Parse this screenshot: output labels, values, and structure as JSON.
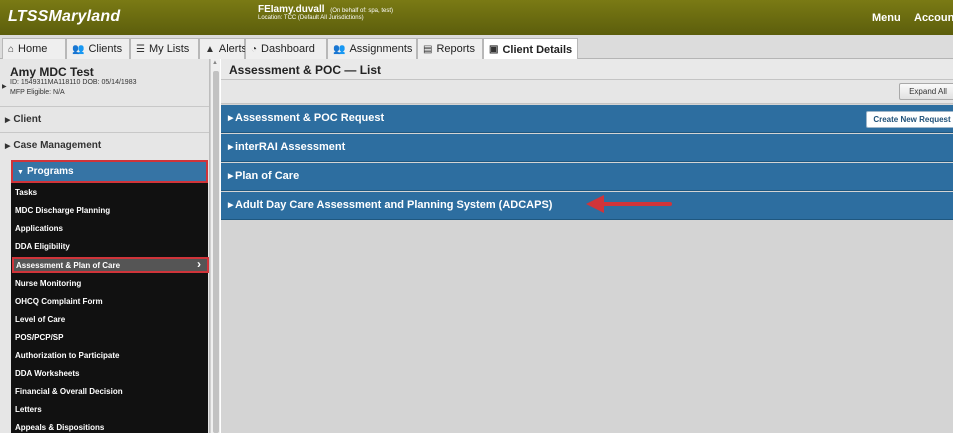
{
  "header": {
    "app_title": "LTSSMaryland",
    "user": "FEIamy.duvall",
    "user_note": "(On behalf of: spa, test)",
    "location": "Location: TCC (Default All Jurisdictions)",
    "menu_label": "Menu",
    "account_label": "Accoun"
  },
  "tabs": [
    {
      "label": "Home",
      "icon": "home-icon"
    },
    {
      "label": "Clients",
      "icon": "users-icon"
    },
    {
      "label": "My Lists",
      "icon": "list-icon"
    },
    {
      "label": "Alerts",
      "icon": "warning-icon"
    },
    {
      "label": "Dashboard",
      "icon": "dashboard-icon"
    },
    {
      "label": "Assignments",
      "icon": "users-icon"
    },
    {
      "label": "Reports",
      "icon": "report-icon"
    },
    {
      "label": "Client Details",
      "icon": "client-card-icon"
    }
  ],
  "client": {
    "name": "Amy MDC Test",
    "id_line": "ID: 1549311MA118110 DOB: 05/14/1983",
    "mfp_line": "MFP Eligible: N/A"
  },
  "sidebar": {
    "sections": [
      "Client",
      "Case Management",
      "Programs"
    ],
    "program_items": [
      "Tasks",
      "MDC Discharge Planning",
      "Applications",
      "DDA Eligibility",
      "Assessment & Plan of Care",
      "Nurse Monitoring",
      "OHCQ Complaint Form",
      "Level of Care",
      "POS/PCP/SP",
      "Authorization to Participate",
      "DDA Worksheets",
      "Financial & Overall Decision",
      "Letters",
      "Appeals & Dispositions"
    ],
    "active_item": "Assessment & Plan of Care"
  },
  "main": {
    "title": "Assessment & POC — List",
    "expand_all": "Expand All",
    "sections": [
      "Assessment & POC Request",
      "interRAI Assessment",
      "Plan of Care",
      "Adult Day Care Assessment and Planning System (ADCAPS)"
    ],
    "create_request": "Create New Request"
  },
  "colors": {
    "topbar": "#6b6d12",
    "section_blue": "#2d6ea0",
    "highlight_red": "#d0343a",
    "sidebar_dark": "#111111"
  }
}
